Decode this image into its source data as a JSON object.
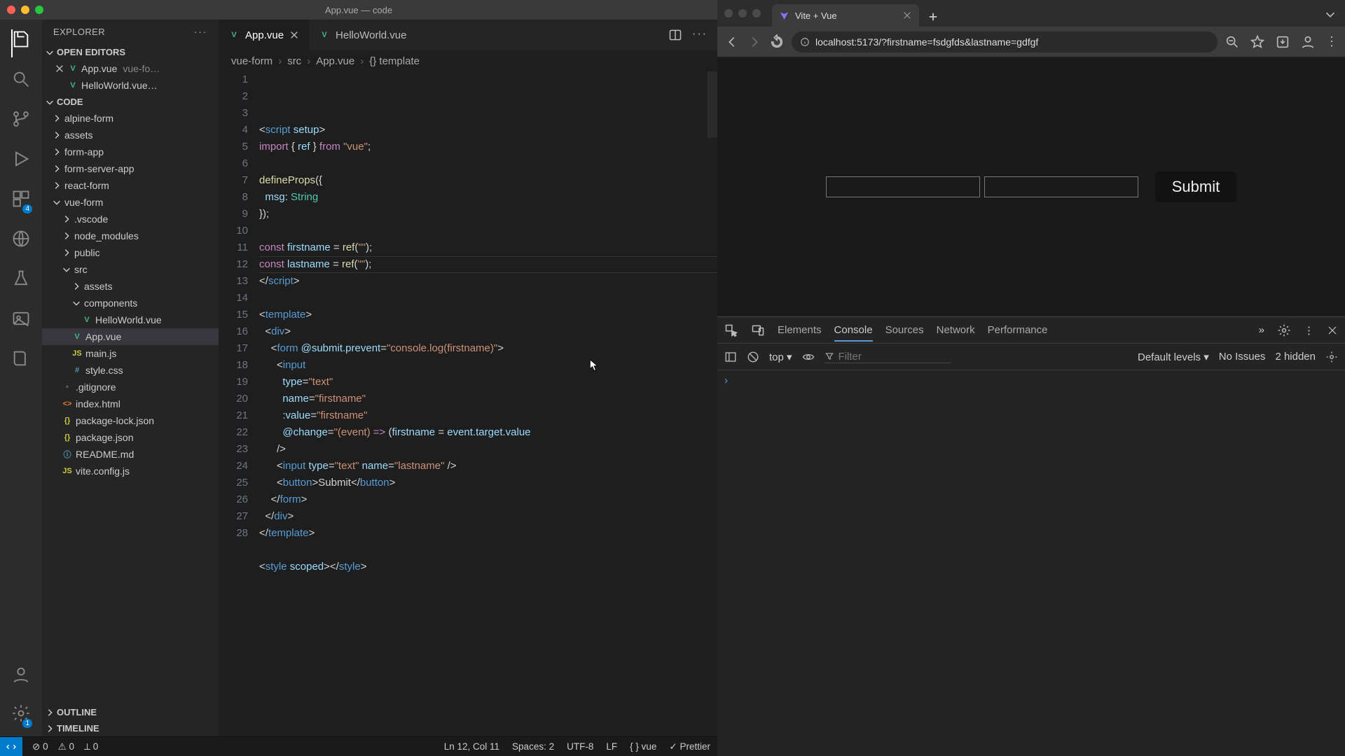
{
  "vscode": {
    "window_title": "App.vue — code",
    "explorer_title": "EXPLORER",
    "sections": {
      "open_editors": "OPEN EDITORS",
      "code": "CODE",
      "outline": "OUTLINE",
      "timeline": "TIMELINE"
    },
    "open_editors": [
      {
        "name": "App.vue",
        "meta": "vue-fo…",
        "icon": "vue"
      },
      {
        "name": "HelloWorld.vue…",
        "meta": "",
        "icon": "vue"
      }
    ],
    "tree": [
      {
        "depth": 0,
        "kind": "folder",
        "open": false,
        "label": "alpine-form"
      },
      {
        "depth": 0,
        "kind": "folder",
        "open": false,
        "label": "assets"
      },
      {
        "depth": 0,
        "kind": "folder",
        "open": false,
        "label": "form-app"
      },
      {
        "depth": 0,
        "kind": "folder",
        "open": false,
        "label": "form-server-app"
      },
      {
        "depth": 0,
        "kind": "folder",
        "open": false,
        "label": "react-form"
      },
      {
        "depth": 0,
        "kind": "folder",
        "open": true,
        "label": "vue-form"
      },
      {
        "depth": 1,
        "kind": "folder",
        "open": false,
        "label": ".vscode"
      },
      {
        "depth": 1,
        "kind": "folder",
        "open": false,
        "label": "node_modules"
      },
      {
        "depth": 1,
        "kind": "folder",
        "open": false,
        "label": "public"
      },
      {
        "depth": 1,
        "kind": "folder",
        "open": true,
        "label": "src"
      },
      {
        "depth": 2,
        "kind": "folder",
        "open": false,
        "label": "assets"
      },
      {
        "depth": 2,
        "kind": "folder",
        "open": true,
        "label": "components"
      },
      {
        "depth": 3,
        "kind": "file",
        "icon": "vue",
        "label": "HelloWorld.vue"
      },
      {
        "depth": 2,
        "kind": "file",
        "icon": "vue",
        "label": "App.vue",
        "selected": true
      },
      {
        "depth": 2,
        "kind": "file",
        "icon": "js",
        "label": "main.js"
      },
      {
        "depth": 2,
        "kind": "file",
        "icon": "css",
        "label": "style.css"
      },
      {
        "depth": 1,
        "kind": "file",
        "icon": "git",
        "label": ".gitignore"
      },
      {
        "depth": 1,
        "kind": "file",
        "icon": "html",
        "label": "index.html"
      },
      {
        "depth": 1,
        "kind": "file",
        "icon": "json",
        "label": "package-lock.json"
      },
      {
        "depth": 1,
        "kind": "file",
        "icon": "json",
        "label": "package.json"
      },
      {
        "depth": 1,
        "kind": "file",
        "icon": "md",
        "label": "README.md"
      },
      {
        "depth": 1,
        "kind": "file",
        "icon": "js",
        "label": "vite.config.js"
      }
    ],
    "tabs": [
      {
        "label": "App.vue",
        "active": true
      },
      {
        "label": "HelloWorld.vue",
        "active": false
      }
    ],
    "breadcrumbs": [
      "vue-form",
      "src",
      "App.vue",
      "{} template"
    ],
    "activity_badges": {
      "extensions": "4",
      "settings": "1"
    },
    "code_lines": [
      {
        "n": 1,
        "html": "<span class='c-txt'>&lt;</span><span class='c-tag'>script</span> <span class='c-attr'>setup</span><span class='c-txt'>&gt;</span>"
      },
      {
        "n": 2,
        "html": "<span class='c-kw'>import</span> <span class='c-txt'>{ </span><span class='c-id'>ref</span><span class='c-txt'> } </span><span class='c-kw'>from</span> <span class='c-str'>\"vue\"</span><span class='c-txt'>;</span>"
      },
      {
        "n": 3,
        "html": ""
      },
      {
        "n": 4,
        "html": "<span class='c-func'>defineProps</span><span class='c-txt'>({</span>"
      },
      {
        "n": 5,
        "html": "  <span class='c-id'>msg</span><span class='c-txt'>: </span><span class='c-type'>String</span>"
      },
      {
        "n": 6,
        "html": "<span class='c-txt'>});</span>"
      },
      {
        "n": 7,
        "html": ""
      },
      {
        "n": 8,
        "html": "<span class='c-kw'>const</span> <span class='c-id'>firstname</span> <span class='c-txt'>= </span><span class='c-func'>ref</span><span class='c-txt'>(</span><span class='c-str'>\"\"</span><span class='c-txt'>);</span>"
      },
      {
        "n": 9,
        "html": "<span class='c-kw'>const</span> <span class='c-id'>lastname</span> <span class='c-txt'>= </span><span class='c-func'>ref</span><span class='c-txt'>(</span><span class='c-str'>\"\"</span><span class='c-txt'>);</span>"
      },
      {
        "n": 10,
        "html": "<span class='c-txt'>&lt;/</span><span class='c-tag'>script</span><span class='c-txt'>&gt;</span>"
      },
      {
        "n": 11,
        "html": ""
      },
      {
        "n": 12,
        "html": "<span class='c-txt'>&lt;</span><span class='c-tag'>template</span><span class='c-txt'>&gt;</span>",
        "active": true
      },
      {
        "n": 13,
        "html": "  <span class='c-txt'>&lt;</span><span class='c-tag'>div</span><span class='c-txt'>&gt;</span>"
      },
      {
        "n": 14,
        "html": "    <span class='c-txt'>&lt;</span><span class='c-tag'>form</span> <span class='c-attr'>@submit.prevent</span><span class='c-txt'>=</span><span class='c-str'>\"console.log(firstname)\"</span><span class='c-txt'>&gt;</span>"
      },
      {
        "n": 15,
        "html": "      <span class='c-txt'>&lt;</span><span class='c-tag'>input</span>"
      },
      {
        "n": 16,
        "html": "        <span class='c-attr'>type</span><span class='c-txt'>=</span><span class='c-str'>\"text\"</span>"
      },
      {
        "n": 17,
        "html": "        <span class='c-attr'>name</span><span class='c-txt'>=</span><span class='c-str'>\"firstname\"</span>"
      },
      {
        "n": 18,
        "html": "        <span class='c-attr'>:value</span><span class='c-txt'>=</span><span class='c-str'>\"firstname\"</span>"
      },
      {
        "n": 19,
        "html": "        <span class='c-attr'>@change</span><span class='c-txt'>=</span><span class='c-str'>\"(event)</span> <span class='c-kw'>=&gt;</span> <span class='c-txt'>(</span><span class='c-id'>firstname</span> <span class='c-txt'>= </span><span class='c-id'>event</span><span class='c-txt'>.</span><span class='c-id'>target</span><span class='c-txt'>.</span><span class='c-id'>value</span>"
      },
      {
        "n": 20,
        "html": "      <span class='c-txt'>/&gt;</span>"
      },
      {
        "n": 21,
        "html": "      <span class='c-txt'>&lt;</span><span class='c-tag'>input</span> <span class='c-attr'>type</span><span class='c-txt'>=</span><span class='c-str'>\"text\"</span> <span class='c-attr'>name</span><span class='c-txt'>=</span><span class='c-str'>\"lastname\"</span> <span class='c-txt'>/&gt;</span>"
      },
      {
        "n": 22,
        "html": "      <span class='c-txt'>&lt;</span><span class='c-tag'>button</span><span class='c-txt'>&gt;Submit&lt;/</span><span class='c-tag'>button</span><span class='c-txt'>&gt;</span>"
      },
      {
        "n": 23,
        "html": "    <span class='c-txt'>&lt;/</span><span class='c-tag'>form</span><span class='c-txt'>&gt;</span>"
      },
      {
        "n": 24,
        "html": "  <span class='c-txt'>&lt;/</span><span class='c-tag'>div</span><span class='c-txt'>&gt;</span>"
      },
      {
        "n": 25,
        "html": "<span class='c-txt'>&lt;/</span><span class='c-tag'>template</span><span class='c-txt'>&gt;</span>"
      },
      {
        "n": 26,
        "html": ""
      },
      {
        "n": 27,
        "html": "<span class='c-txt'>&lt;</span><span class='c-tag'>style</span> <span class='c-attr'>scoped</span><span class='c-txt'>&gt;&lt;/</span><span class='c-tag'>style</span><span class='c-txt'>&gt;</span>"
      },
      {
        "n": 28,
        "html": ""
      }
    ],
    "status": {
      "errors": "0",
      "warnings": "0",
      "ports": "0",
      "position": "Ln 12, Col 11",
      "spaces": "Spaces: 2",
      "encoding": "UTF-8",
      "eol": "LF",
      "language": "vue",
      "prettier": "Prettier"
    }
  },
  "browser": {
    "tab_title": "Vite + Vue",
    "url": "localhost:5173/?firstname=fsdgfds&lastname=gdfgf",
    "submit_label": "Submit"
  },
  "devtools": {
    "tabs": [
      "Elements",
      "Console",
      "Sources",
      "Network",
      "Performance"
    ],
    "active_tab": "Console",
    "context": "top",
    "filter_placeholder": "Filter",
    "levels": "Default levels",
    "issues": "No Issues",
    "hidden": "2 hidden"
  }
}
